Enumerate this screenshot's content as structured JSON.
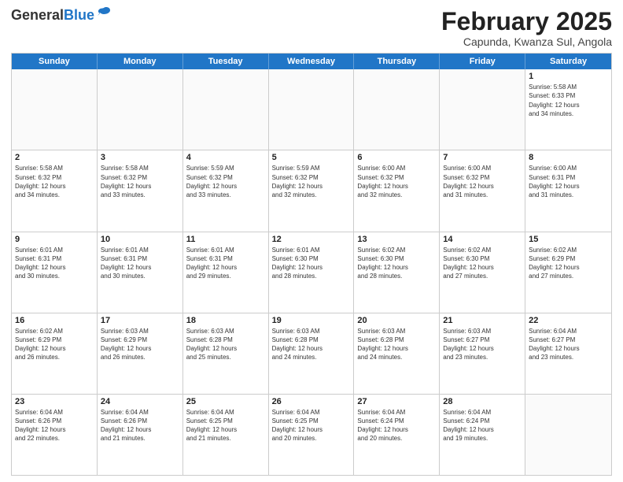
{
  "header": {
    "logo_general": "General",
    "logo_blue": "Blue",
    "title": "February 2025",
    "location": "Capunda, Kwanza Sul, Angola"
  },
  "days_of_week": [
    "Sunday",
    "Monday",
    "Tuesday",
    "Wednesday",
    "Thursday",
    "Friday",
    "Saturday"
  ],
  "weeks": [
    {
      "cells": [
        {
          "day": null,
          "info": ""
        },
        {
          "day": null,
          "info": ""
        },
        {
          "day": null,
          "info": ""
        },
        {
          "day": null,
          "info": ""
        },
        {
          "day": null,
          "info": ""
        },
        {
          "day": null,
          "info": ""
        },
        {
          "day": "1",
          "info": "Sunrise: 5:58 AM\nSunset: 6:33 PM\nDaylight: 12 hours\nand 34 minutes."
        }
      ]
    },
    {
      "cells": [
        {
          "day": "2",
          "info": "Sunrise: 5:58 AM\nSunset: 6:32 PM\nDaylight: 12 hours\nand 34 minutes."
        },
        {
          "day": "3",
          "info": "Sunrise: 5:58 AM\nSunset: 6:32 PM\nDaylight: 12 hours\nand 33 minutes."
        },
        {
          "day": "4",
          "info": "Sunrise: 5:59 AM\nSunset: 6:32 PM\nDaylight: 12 hours\nand 33 minutes."
        },
        {
          "day": "5",
          "info": "Sunrise: 5:59 AM\nSunset: 6:32 PM\nDaylight: 12 hours\nand 32 minutes."
        },
        {
          "day": "6",
          "info": "Sunrise: 6:00 AM\nSunset: 6:32 PM\nDaylight: 12 hours\nand 32 minutes."
        },
        {
          "day": "7",
          "info": "Sunrise: 6:00 AM\nSunset: 6:32 PM\nDaylight: 12 hours\nand 31 minutes."
        },
        {
          "day": "8",
          "info": "Sunrise: 6:00 AM\nSunset: 6:31 PM\nDaylight: 12 hours\nand 31 minutes."
        }
      ]
    },
    {
      "cells": [
        {
          "day": "9",
          "info": "Sunrise: 6:01 AM\nSunset: 6:31 PM\nDaylight: 12 hours\nand 30 minutes."
        },
        {
          "day": "10",
          "info": "Sunrise: 6:01 AM\nSunset: 6:31 PM\nDaylight: 12 hours\nand 30 minutes."
        },
        {
          "day": "11",
          "info": "Sunrise: 6:01 AM\nSunset: 6:31 PM\nDaylight: 12 hours\nand 29 minutes."
        },
        {
          "day": "12",
          "info": "Sunrise: 6:01 AM\nSunset: 6:30 PM\nDaylight: 12 hours\nand 28 minutes."
        },
        {
          "day": "13",
          "info": "Sunrise: 6:02 AM\nSunset: 6:30 PM\nDaylight: 12 hours\nand 28 minutes."
        },
        {
          "day": "14",
          "info": "Sunrise: 6:02 AM\nSunset: 6:30 PM\nDaylight: 12 hours\nand 27 minutes."
        },
        {
          "day": "15",
          "info": "Sunrise: 6:02 AM\nSunset: 6:29 PM\nDaylight: 12 hours\nand 27 minutes."
        }
      ]
    },
    {
      "cells": [
        {
          "day": "16",
          "info": "Sunrise: 6:02 AM\nSunset: 6:29 PM\nDaylight: 12 hours\nand 26 minutes."
        },
        {
          "day": "17",
          "info": "Sunrise: 6:03 AM\nSunset: 6:29 PM\nDaylight: 12 hours\nand 26 minutes."
        },
        {
          "day": "18",
          "info": "Sunrise: 6:03 AM\nSunset: 6:28 PM\nDaylight: 12 hours\nand 25 minutes."
        },
        {
          "day": "19",
          "info": "Sunrise: 6:03 AM\nSunset: 6:28 PM\nDaylight: 12 hours\nand 24 minutes."
        },
        {
          "day": "20",
          "info": "Sunrise: 6:03 AM\nSunset: 6:28 PM\nDaylight: 12 hours\nand 24 minutes."
        },
        {
          "day": "21",
          "info": "Sunrise: 6:03 AM\nSunset: 6:27 PM\nDaylight: 12 hours\nand 23 minutes."
        },
        {
          "day": "22",
          "info": "Sunrise: 6:04 AM\nSunset: 6:27 PM\nDaylight: 12 hours\nand 23 minutes."
        }
      ]
    },
    {
      "cells": [
        {
          "day": "23",
          "info": "Sunrise: 6:04 AM\nSunset: 6:26 PM\nDaylight: 12 hours\nand 22 minutes."
        },
        {
          "day": "24",
          "info": "Sunrise: 6:04 AM\nSunset: 6:26 PM\nDaylight: 12 hours\nand 21 minutes."
        },
        {
          "day": "25",
          "info": "Sunrise: 6:04 AM\nSunset: 6:25 PM\nDaylight: 12 hours\nand 21 minutes."
        },
        {
          "day": "26",
          "info": "Sunrise: 6:04 AM\nSunset: 6:25 PM\nDaylight: 12 hours\nand 20 minutes."
        },
        {
          "day": "27",
          "info": "Sunrise: 6:04 AM\nSunset: 6:24 PM\nDaylight: 12 hours\nand 20 minutes."
        },
        {
          "day": "28",
          "info": "Sunrise: 6:04 AM\nSunset: 6:24 PM\nDaylight: 12 hours\nand 19 minutes."
        },
        {
          "day": null,
          "info": ""
        }
      ]
    }
  ]
}
